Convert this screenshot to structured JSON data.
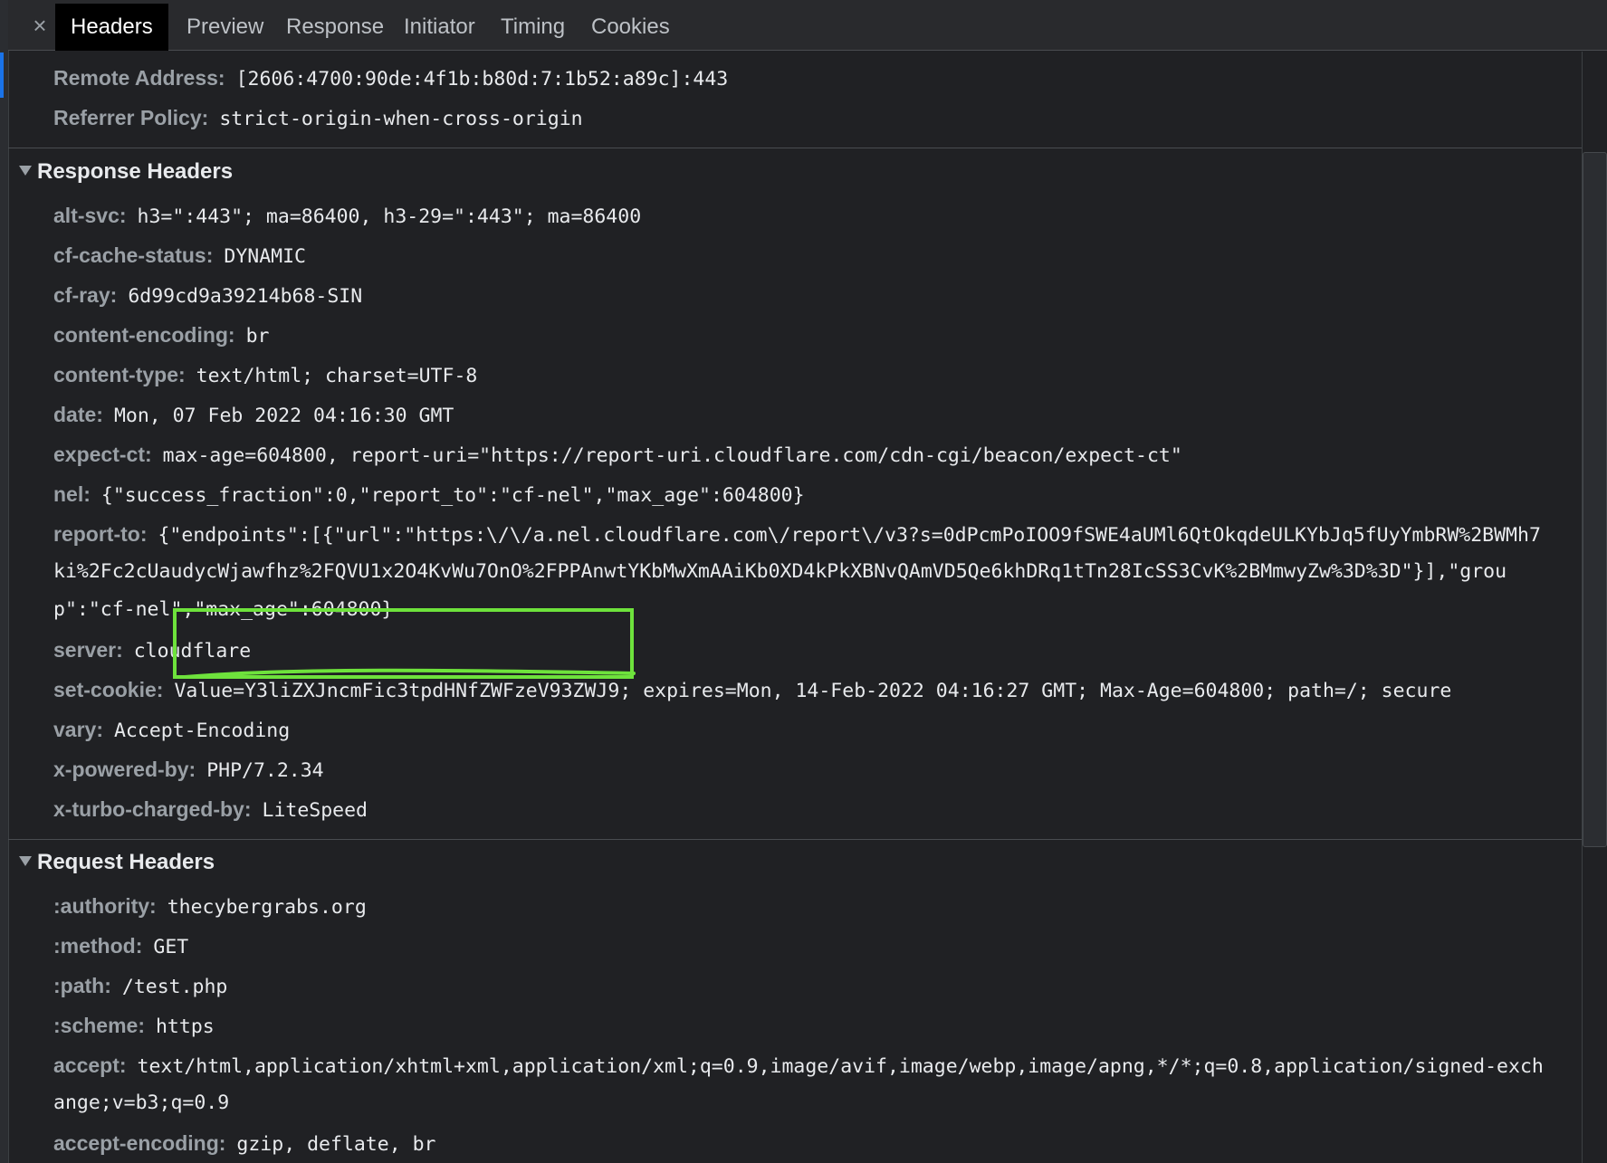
{
  "tabs": {
    "close_glyph": "×",
    "items": [
      "Headers",
      "Preview",
      "Response",
      "Initiator",
      "Timing",
      "Cookies"
    ],
    "active": "Headers"
  },
  "general": [
    {
      "key": "Remote Address:",
      "value": "[2606:4700:90de:4f1b:b80d:7:1b52:a89c]:443"
    },
    {
      "key": "Referrer Policy:",
      "value": "strict-origin-when-cross-origin"
    }
  ],
  "response_headers": {
    "title": "Response Headers",
    "items": [
      {
        "key": "alt-svc:",
        "value": "h3=\":443\"; ma=86400, h3-29=\":443\"; ma=86400"
      },
      {
        "key": "cf-cache-status:",
        "value": "DYNAMIC"
      },
      {
        "key": "cf-ray:",
        "value": "6d99cd9a39214b68-SIN"
      },
      {
        "key": "content-encoding:",
        "value": "br"
      },
      {
        "key": "content-type:",
        "value": "text/html; charset=UTF-8"
      },
      {
        "key": "date:",
        "value": "Mon, 07 Feb 2022 04:16:30 GMT"
      },
      {
        "key": "expect-ct:",
        "value": "max-age=604800, report-uri=\"https://report-uri.cloudflare.com/cdn-cgi/beacon/expect-ct\""
      },
      {
        "key": "nel:",
        "value": "{\"success_fraction\":0,\"report_to\":\"cf-nel\",\"max_age\":604800}"
      },
      {
        "key": "report-to:",
        "value": "{\"endpoints\":[{\"url\":\"https:\\/\\/a.nel.cloudflare.com\\/report\\/v3?s=0dPcmPoIOO9fSWE4aUMl6QtOkqdeULKYbJq5fUyYmbRW%2BWMh7",
        "value_line2": "ki%2Fc2cUaudycWjawfhz%2FQVU1x2O4KvWu7OnO%2FPPAnwtYKbMwXmAAiKb0XD4kPkXBNvQAmVD5Qe6khDRq1tTn28IcSS3CvK%2BMmwyZw%3D%3D\"}],\"grou",
        "value_line3": "p\":\"cf-nel\",\"max_age\":604800}"
      },
      {
        "key": "server:",
        "value": "cloudflare"
      },
      {
        "key": "set-cookie:",
        "value": "Value=Y3liZXJncmFic3tpdHNfZWFzeV93ZWJ9; expires=Mon, 14-Feb-2022 04:16:27 GMT; Max-Age=604800; path=/; secure"
      },
      {
        "key": "vary:",
        "value": "Accept-Encoding"
      },
      {
        "key": "x-powered-by:",
        "value": "PHP/7.2.34"
      },
      {
        "key": "x-turbo-charged-by:",
        "value": "LiteSpeed"
      }
    ]
  },
  "request_headers": {
    "title": "Request Headers",
    "items": [
      {
        "key": ":authority:",
        "value": "thecybergrabs.org"
      },
      {
        "key": ":method:",
        "value": "GET"
      },
      {
        "key": ":path:",
        "value": "/test.php"
      },
      {
        "key": ":scheme:",
        "value": "https"
      },
      {
        "key": "accept:",
        "value": "text/html,application/xhtml+xml,application/xml;q=0.9,image/avif,image/webp,image/apng,*/*;q=0.8,application/signed-exch",
        "value_line2": "ange;v=b3;q=0.9"
      },
      {
        "key": "accept-encoding:",
        "value": "gzip, deflate, br"
      }
    ]
  },
  "annotation": {
    "color": "#6ee23c"
  }
}
